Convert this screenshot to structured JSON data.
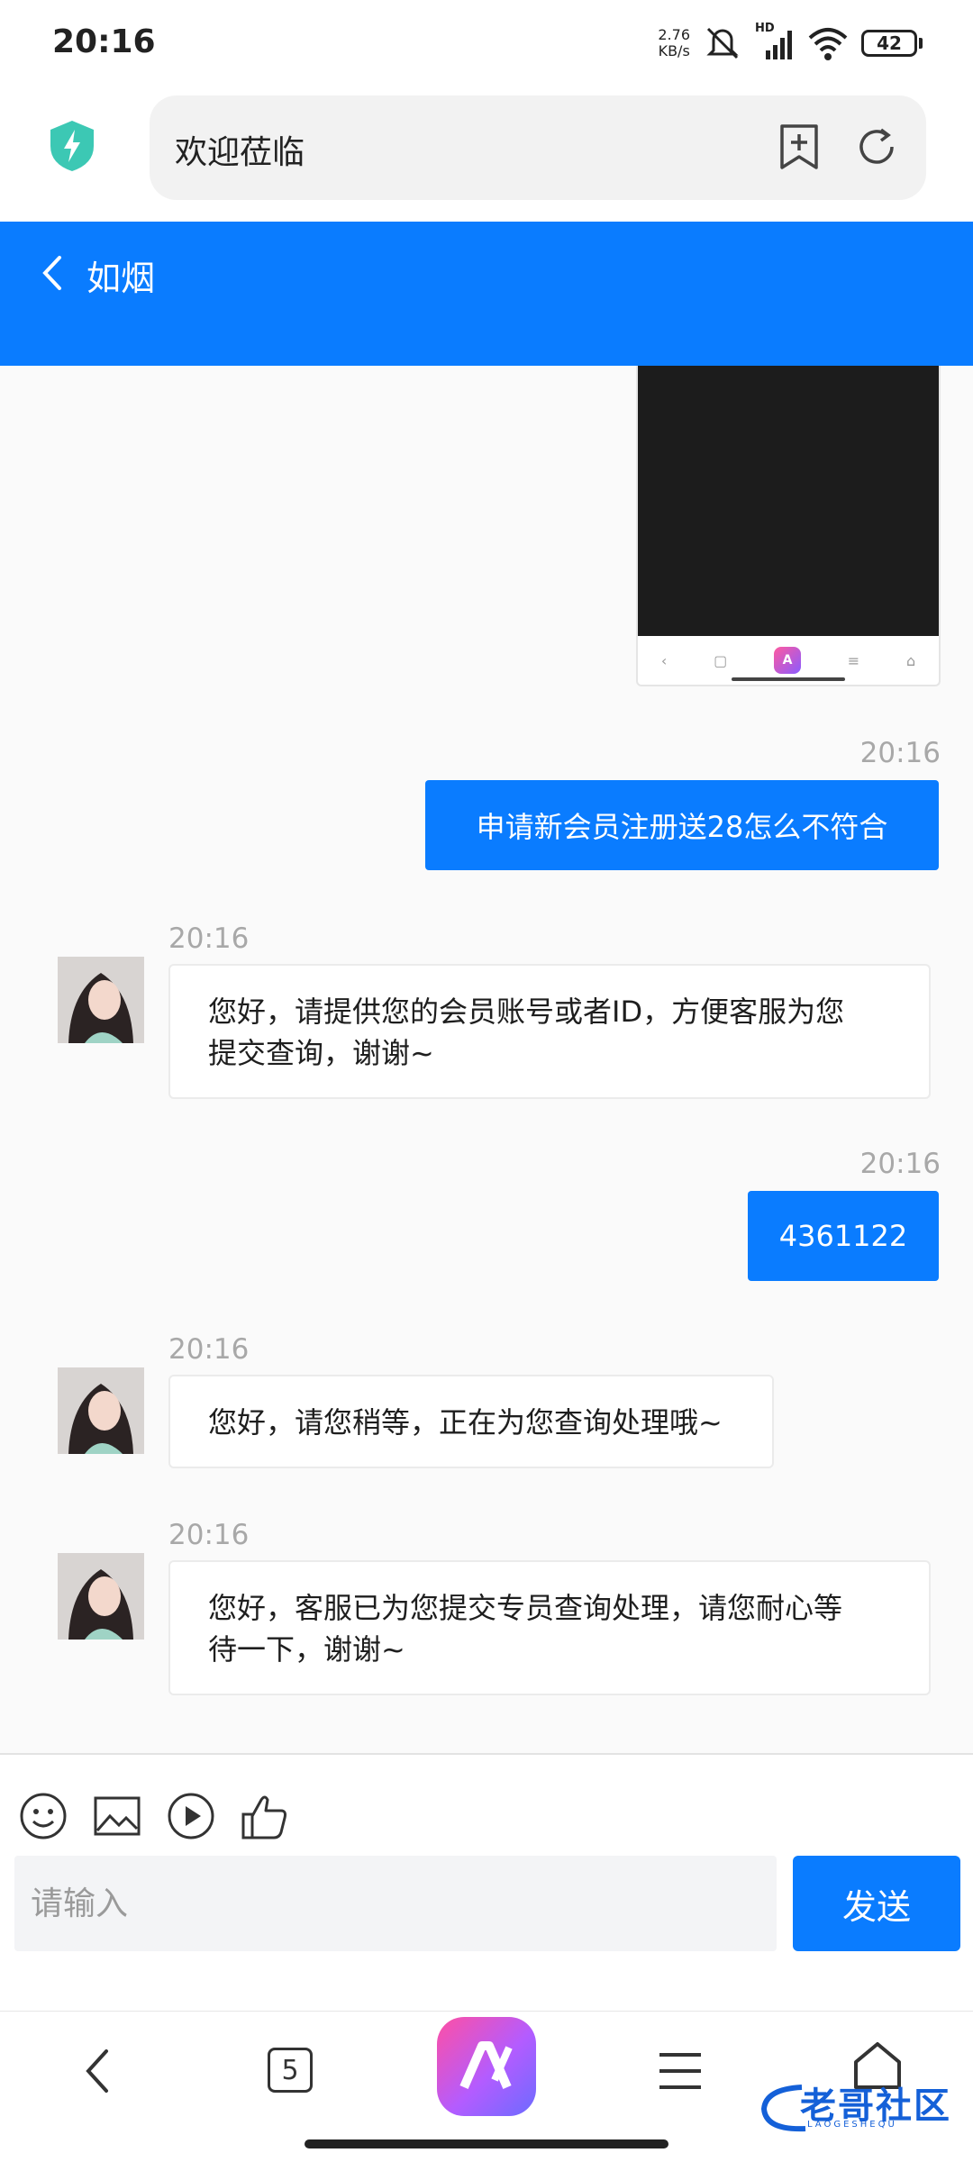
{
  "status_bar": {
    "time": "20:16",
    "net_speed_value": "2.76",
    "net_speed_unit": "KB/s",
    "signal_label": "HD",
    "battery": "42"
  },
  "browser": {
    "url_text": "欢迎莅临",
    "shield_color": "#3cc8b4"
  },
  "chat": {
    "title": "如烟",
    "accent_color": "#0a7cff",
    "messages": [
      {
        "side": "out",
        "time": "20:16",
        "text": "申请新会员注册送28怎么不符合"
      },
      {
        "side": "in",
        "time": "20:16",
        "line1": "您好，请提供您的会员账号或者ID，方便客服为您",
        "line2": "提交查询，谢谢~"
      },
      {
        "side": "out",
        "time": "20:16",
        "text": "4361122"
      },
      {
        "side": "in",
        "time": "20:16",
        "text": "您好，请您稍等，正在为您查询处理哦~"
      },
      {
        "side": "in",
        "time": "20:16",
        "line1": "您好，客服已为您提交专员查询处理，请您耐心等",
        "line2": "待一下，谢谢~"
      }
    ]
  },
  "input": {
    "placeholder": "请输入",
    "send_label": "发送",
    "tools": [
      "emoji-icon",
      "image-icon",
      "video-icon",
      "thumbs-up-icon"
    ]
  },
  "bottom_nav": {
    "tab_count": "5",
    "watermark_text": "老哥社区",
    "watermark_sub": "LAOGESHEQU"
  }
}
